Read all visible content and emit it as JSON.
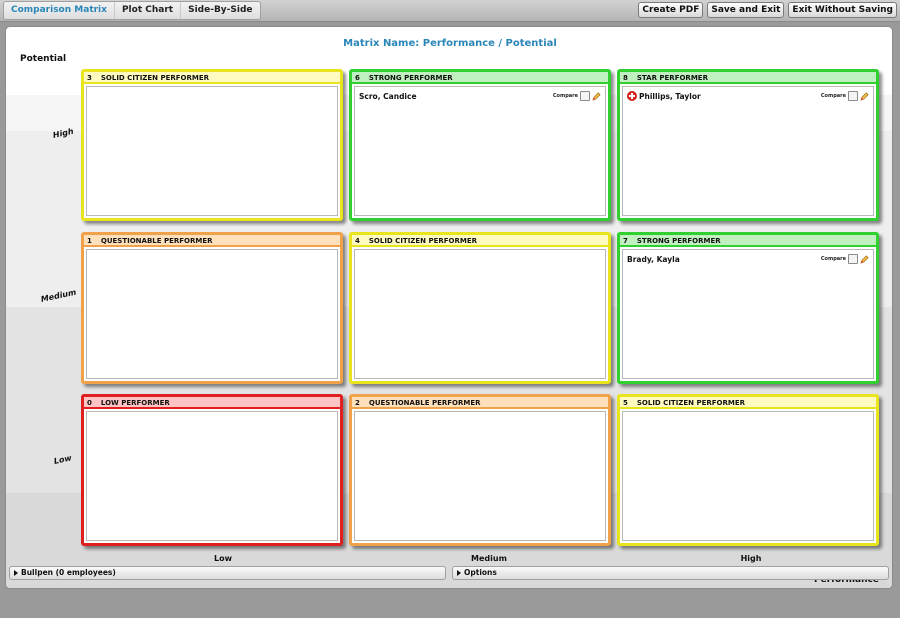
{
  "toolbar": {
    "tabs": [
      {
        "label": "Comparison Matrix",
        "active": true
      },
      {
        "label": "Plot Chart",
        "active": false
      },
      {
        "label": "Side-By-Side",
        "active": false
      }
    ],
    "buttons": {
      "create_pdf": "Create PDF",
      "save_exit": "Save and Exit",
      "exit_no_save": "Exit Without Saving"
    }
  },
  "matrix": {
    "title": "Matrix Name: Performance / Potential",
    "y_axis_title": "Potential",
    "x_axis_title": "Performance",
    "y_labels": [
      "High",
      "Medium",
      "Low"
    ],
    "x_labels": [
      "Low",
      "Medium",
      "High"
    ],
    "boxes": [
      {
        "number": "3",
        "title": "SOLID CITIZEN PERFORMER",
        "color": "yellow",
        "employees": []
      },
      {
        "number": "6",
        "title": "STRONG PERFORMER",
        "color": "green",
        "employees": [
          {
            "name": "Scro, Candice",
            "compare_label": "Compare",
            "flagged": false
          }
        ]
      },
      {
        "number": "8",
        "title": "STAR PERFORMER",
        "color": "green",
        "employees": [
          {
            "name": "Phillips, Taylor",
            "compare_label": "Compare",
            "flagged": true
          }
        ]
      },
      {
        "number": "1",
        "title": "QUESTIONABLE PERFORMER",
        "color": "orange",
        "employees": []
      },
      {
        "number": "4",
        "title": "SOLID CITIZEN PERFORMER",
        "color": "yellow",
        "employees": []
      },
      {
        "number": "7",
        "title": "STRONG PERFORMER",
        "color": "green",
        "employees": [
          {
            "name": "Brady, Kayla",
            "compare_label": "Compare",
            "flagged": false
          }
        ]
      },
      {
        "number": "0",
        "title": "LOW PERFORMER",
        "color": "red",
        "employees": []
      },
      {
        "number": "2",
        "title": "QUESTIONABLE PERFORMER",
        "color": "orange",
        "employees": []
      },
      {
        "number": "5",
        "title": "SOLID CITIZEN PERFORMER",
        "color": "yellow",
        "employees": []
      }
    ]
  },
  "bottom": {
    "bullpen_label": "Bullpen (0 employees)",
    "options_label": "Options"
  },
  "colors": {
    "accent": "#2a86b8",
    "yellow": "#e8e41e",
    "green": "#30d030",
    "orange": "#f0a24a",
    "red": "#e02020"
  }
}
